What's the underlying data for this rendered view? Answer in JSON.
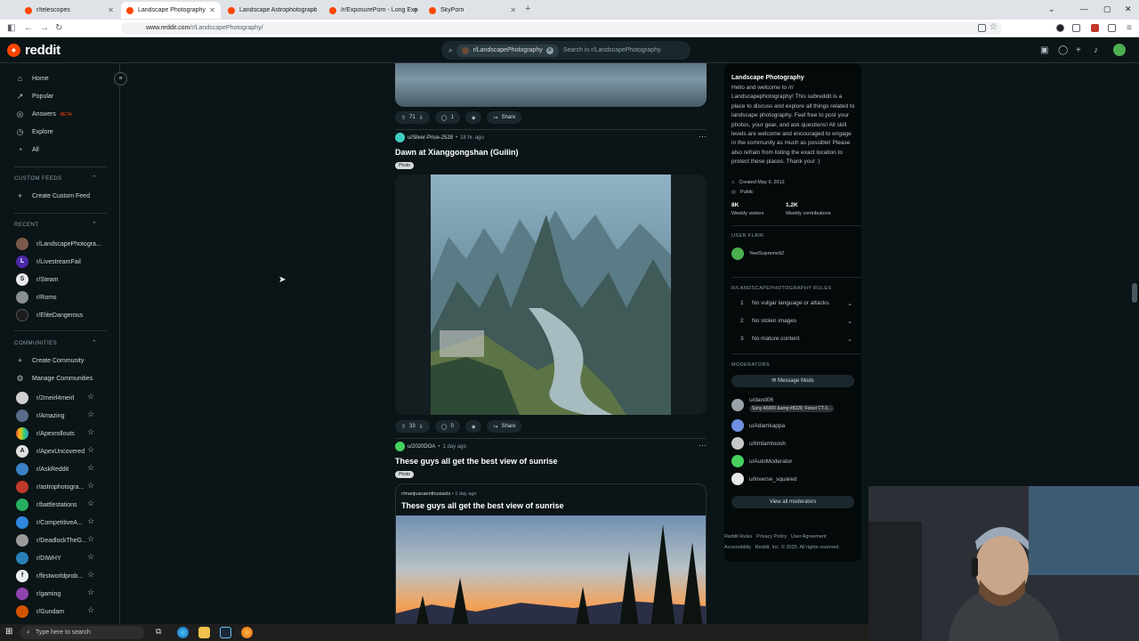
{
  "browser": {
    "tabs": [
      {
        "title": "r/telescopes",
        "active": false
      },
      {
        "title": "Landscape Photography",
        "active": true
      },
      {
        "title": "Landscape Astrophotography",
        "active": false
      },
      {
        "title": "/r/ExposurePorn - Long Exposu",
        "active": false
      },
      {
        "title": "SkyPorn",
        "active": false
      }
    ],
    "url_host": "www.reddit.com",
    "url_path": "/r/LandscapePhotography/"
  },
  "header": {
    "logo_text": "reddit",
    "search_chip": "r/LandscapePhotography",
    "search_placeholder": "Search in r/LandscapePhotography"
  },
  "sidebar": {
    "nav": [
      {
        "label": "Home",
        "icon": "home-icon"
      },
      {
        "label": "Popular",
        "icon": "popular-icon"
      },
      {
        "label": "Answers",
        "icon": "answers-icon",
        "badge": "BETA"
      },
      {
        "label": "Explore",
        "icon": "explore-icon"
      },
      {
        "label": "All",
        "icon": "all-icon"
      }
    ],
    "custom_feeds_heading": "CUSTOM FEEDS",
    "create_custom_feed": "Create Custom Feed",
    "recent_heading": "RECENT",
    "recent": [
      "r/LandscapePhotogra...",
      "r/LivestreamFail",
      "r/Steam",
      "r/Roms",
      "r/EliteDangerous"
    ],
    "communities_heading": "COMMUNITIES",
    "create_community": "Create Community",
    "manage_communities": "Manage Communities",
    "communities": [
      "r/2meirl4meirl",
      "r/Amazing",
      "r/Apexrollouts",
      "r/ApexUncovered",
      "r/AskReddit",
      "r/astrophotogra...",
      "r/battlestations",
      "r/CompetitiveA...",
      "r/DeadlockTheG...",
      "r/DIWHY",
      "r/firstworldprob...",
      "r/gaming",
      "r/Gundam"
    ]
  },
  "feed": {
    "post0": {
      "votes": "71",
      "comments": "1",
      "share": "Share"
    },
    "post1": {
      "user": "u/Silver-Price-2528",
      "age": "18 hr. ago",
      "title": "Dawn at Xianggongshan (Guilin)",
      "flair": "Photo",
      "votes": "33",
      "comments": "0",
      "share": "Share"
    },
    "post2": {
      "user": "u/2020DOA",
      "age": "1 day ago",
      "title": "These guys all get the best view of sunrise",
      "flair": "Photo",
      "crosspost_sub": "r/marijuanaenthusiasts",
      "crosspost_age": "1 day ago",
      "crosspost_title": "These guys all get the best view of sunrise"
    }
  },
  "about": {
    "title": "Landscape Photography",
    "description": "Hello and welcome to /r/ Landscapephotography! This subreddit is a place to discuss and explore all things related to landscape photography. Feel free to post your photos, your gear, and ask questions! All skill levels are welcome and encouraged to engage in the community as much as possible! Please also refrain from listing the exact location to protect these places. Thank you! :)",
    "created": "Created May 9, 2012",
    "visibility": "Public",
    "weekly_visitors": "8K",
    "weekly_visitors_label": "Weekly visitors",
    "weekly_contrib": "1.2K",
    "weekly_contrib_label": "Weekly contributions",
    "user_flair_heading": "USER FLAIR",
    "user_flair_name": "YeetSupreme92",
    "rules_heading": "R/LANDSCAPEPHOTOGRAPHY RULES",
    "rules": [
      {
        "num": "1",
        "text": "No vulgar language or attacks."
      },
      {
        "num": "2",
        "text": "No stolen images"
      },
      {
        "num": "3",
        "text": "No mature content"
      }
    ],
    "moderators_heading": "MODERATORS",
    "message_mods": "Message Mods",
    "moderators": [
      {
        "name": "u/dand06",
        "flair": "Sony A6000 &amp;#8226; Feisol CT-3...",
        "color": "#9aa4a8"
      },
      {
        "name": "u/Adamkappa",
        "flair": "",
        "color": "#6f8fe0"
      },
      {
        "name": "u/timtamtoosh",
        "flair": "",
        "color": "#c9c9c9"
      },
      {
        "name": "u/AutoModerator",
        "flair": "",
        "color": "#46d160"
      },
      {
        "name": "u/inverse_squared",
        "flair": "",
        "color": "#e8e8e8"
      }
    ],
    "view_all_mods": "View all moderators"
  },
  "footer": {
    "links": [
      "Reddit Rules",
      "Privacy Policy",
      "User Agreement",
      "Accessibility"
    ],
    "copyright": "Reddit, Inc. © 2025. All rights reserved."
  },
  "taskbar": {
    "search_placeholder": "Type here to search"
  }
}
